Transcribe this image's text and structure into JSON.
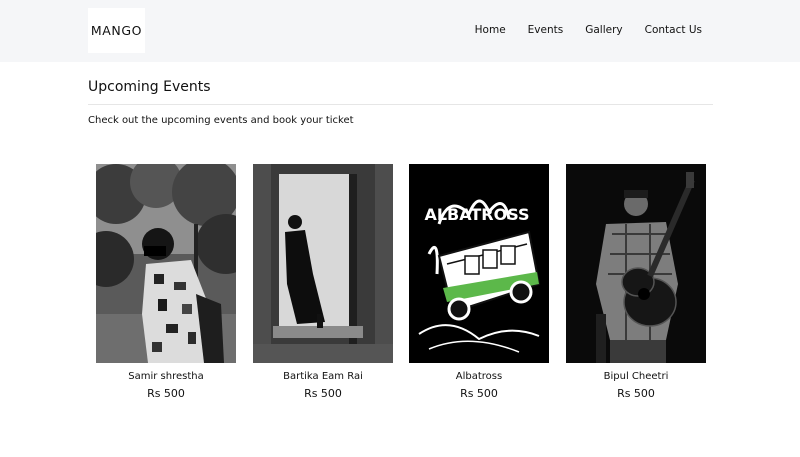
{
  "header": {
    "logo_text": "MANGO",
    "nav": [
      "Home",
      "Events",
      "Gallery",
      "Contact Us"
    ]
  },
  "main": {
    "title": "Upcoming Events",
    "subtitle": "Check out the upcoming events and book your ticket"
  },
  "events": [
    {
      "name": "Samir shrestha",
      "price": "Rs 500"
    },
    {
      "name": "Bartika Eam Rai",
      "price": "Rs 500"
    },
    {
      "name": "Albatross",
      "price": "Rs 500",
      "poster_text": "ALBATROSS"
    },
    {
      "name": "Bipul Cheetri",
      "price": "Rs 500"
    }
  ]
}
